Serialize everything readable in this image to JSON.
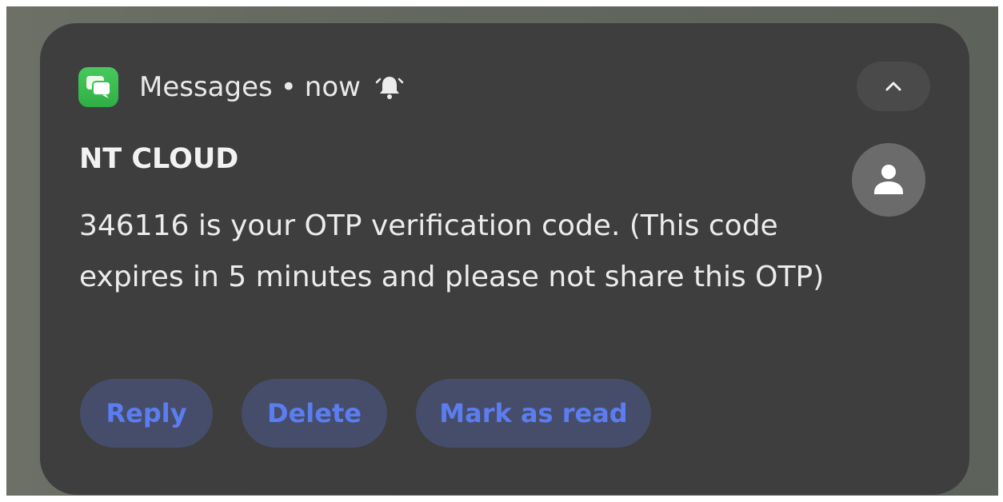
{
  "notification": {
    "app_name": "Messages",
    "separator": "•",
    "time": "now",
    "sender": "NT CLOUD",
    "message": "346116 is your OTP verification code. (This code expires in 5 minutes and please not share this OTP)",
    "actions": [
      {
        "label": "Reply"
      },
      {
        "label": "Delete"
      },
      {
        "label": "Mark as read"
      }
    ]
  },
  "icons": {
    "app": "messages-app-icon",
    "alert": "alert-bell-icon",
    "collapse": "chevron-up-icon",
    "avatar": "person-icon"
  },
  "colors": {
    "card_bg": "#3e3e3e",
    "button_bg": "#464d6a",
    "button_text": "#5b7df0",
    "app_icon": "#3cbf52"
  }
}
